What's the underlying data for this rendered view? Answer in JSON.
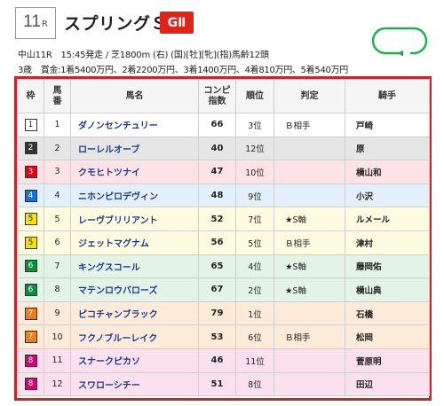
{
  "header": {
    "race_number": "11",
    "race_suffix": "R",
    "race_name": "スプリングＳ",
    "grade": "GⅡ",
    "info_line1": "中山11R　15:45発走 / 芝1800m (右) (国)[牡][牝](指)馬齢12頭",
    "info_line2_age": "3歳",
    "info_line2_prize": "賞金:1着5400万円、2着2200万円、3着1400万円、4着810万円、5着540万円"
  },
  "course_icon": "oval-course-icon",
  "colors": {
    "accent": "#c9252d",
    "grade_bg": "#e2231a",
    "course_icon": "#1bb04a",
    "horse_name": "#1b3a8f"
  },
  "table": {
    "headers": {
      "waku": "枠",
      "umaban": "馬\n番",
      "name": "馬名",
      "comp": "コンピ\n指数",
      "rank": "順位",
      "judge": "判定",
      "jockey": "騎手"
    },
    "rows": [
      {
        "waku": "1",
        "umaban": "1",
        "name": "ダノンセンチュリー",
        "comp": "66",
        "rank": "3位",
        "judge": "Ｂ相手",
        "jockey": "戸崎",
        "waku_bg": "#ffffff",
        "waku_fg": "#222222",
        "row_bg": "#ffffff"
      },
      {
        "waku": "2",
        "umaban": "2",
        "name": "ローレルオーブ",
        "comp": "40",
        "rank": "12位",
        "judge": "",
        "jockey": "原",
        "waku_bg": "#333333",
        "waku_fg": "#ffffff",
        "row_bg": "#e6e6e6"
      },
      {
        "waku": "3",
        "umaban": "3",
        "name": "クモヒトツナイ",
        "comp": "47",
        "rank": "10位",
        "judge": "",
        "jockey": "横山和",
        "waku_bg": "#e60012",
        "waku_fg": "#ffffff",
        "row_bg": "#fde3e6"
      },
      {
        "waku": "4",
        "umaban": "4",
        "name": "ニホンピロデヴィン",
        "comp": "48",
        "rank": "9位",
        "judge": "",
        "jockey": "小沢",
        "waku_bg": "#1d6fd6",
        "waku_fg": "#ffffff",
        "row_bg": "#e3f0fb"
      },
      {
        "waku": "5",
        "umaban": "5",
        "name": "レーヴブリリアント",
        "comp": "52",
        "rank": "7位",
        "judge": "★S軸",
        "jockey": "ルメール",
        "waku_bg": "#f5e500",
        "waku_fg": "#222222",
        "row_bg": "#fdfbe0"
      },
      {
        "waku": "5",
        "umaban": "6",
        "name": "ジェットマグナム",
        "comp": "56",
        "rank": "5位",
        "judge": "Ｂ相手",
        "jockey": "津村",
        "waku_bg": "#f5e500",
        "waku_fg": "#222222",
        "row_bg": "#fdfbe0"
      },
      {
        "waku": "6",
        "umaban": "7",
        "name": "キングスコール",
        "comp": "65",
        "rank": "4位",
        "judge": "★S軸",
        "jockey": "藤岡佑",
        "waku_bg": "#0a8f3d",
        "waku_fg": "#ffffff",
        "row_bg": "#e3f4e6"
      },
      {
        "waku": "6",
        "umaban": "8",
        "name": "マテンロウバローズ",
        "comp": "67",
        "rank": "2位",
        "judge": "★S軸",
        "jockey": "横山典",
        "waku_bg": "#0a8f3d",
        "waku_fg": "#ffffff",
        "row_bg": "#e3f4e6"
      },
      {
        "waku": "7",
        "umaban": "9",
        "name": "ピコチャンブラック",
        "comp": "79",
        "rank": "1位",
        "judge": "",
        "jockey": "石橋",
        "waku_bg": "#ef7d1a",
        "waku_fg": "#ffffff",
        "row_bg": "#fdebd9"
      },
      {
        "waku": "7",
        "umaban": "10",
        "name": "フクノブルーレイク",
        "comp": "53",
        "rank": "6位",
        "judge": "Ｂ相手",
        "jockey": "松岡",
        "waku_bg": "#ef7d1a",
        "waku_fg": "#ffffff",
        "row_bg": "#fdebd9"
      },
      {
        "waku": "8",
        "umaban": "11",
        "name": "スナークピカソ",
        "comp": "46",
        "rank": "11位",
        "judge": "",
        "jockey": "菅原明",
        "waku_bg": "#d6006f",
        "waku_fg": "#ffffff",
        "row_bg": "#fbe0ee"
      },
      {
        "waku": "8",
        "umaban": "12",
        "name": "スワローシチー",
        "comp": "51",
        "rank": "8位",
        "judge": "",
        "jockey": "田辺",
        "waku_bg": "#d6006f",
        "waku_fg": "#ffffff",
        "row_bg": "#fbe0ee"
      }
    ]
  }
}
